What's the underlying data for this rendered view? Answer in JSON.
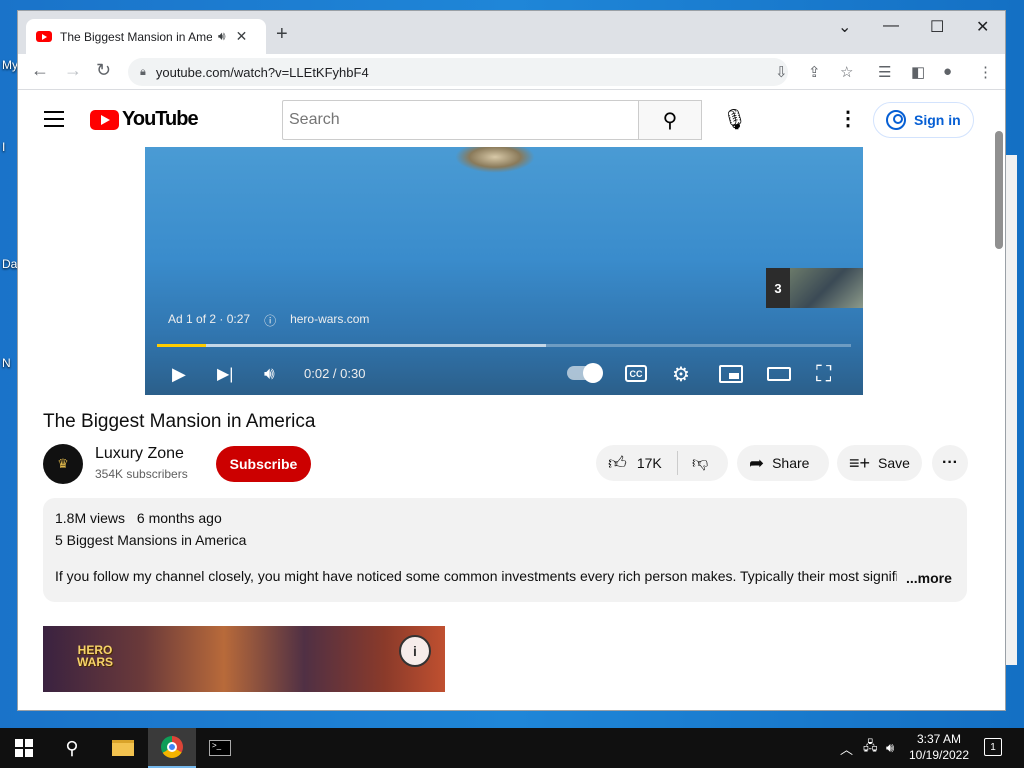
{
  "desktop": {
    "labels": [
      "My",
      "I",
      "Da",
      "N"
    ]
  },
  "browser": {
    "tab_title": "The Biggest Mansion in America",
    "new_tab": "+",
    "url": "youtube.com/watch?v=LLEtKFyhbF4"
  },
  "youtube": {
    "logo_text": "YouTube",
    "search_placeholder": "Search",
    "sign_in": "Sign in"
  },
  "player": {
    "ad_label": "Ad 1 of 2 · 0:27",
    "ad_domain": "hero-wars.com",
    "next_count": "3",
    "time": "0:02 / 0:30",
    "played_fraction": 0.07,
    "buffered_fraction": 0.56,
    "cc_label": "CC"
  },
  "video": {
    "title": "The Biggest Mansion in America",
    "channel_name": "Luxury Zone",
    "subscribers": "354K subscribers",
    "subscribe_label": "Subscribe",
    "like_count": "17K",
    "share_label": "Share",
    "save_label": "Save"
  },
  "description": {
    "views": "1.8M views",
    "age": "6 months ago",
    "line2": "5 Biggest Mansions in America",
    "body": "If you follow my channel closely, you might have noticed some common investments every rich person makes. Typically their most significant",
    "more": "...more"
  },
  "banner": {
    "logo_line1": "HERO",
    "logo_line2": "WARS"
  },
  "taskbar": {
    "time": "3:37 AM",
    "date": "10/19/2022",
    "notification_count": "1"
  }
}
